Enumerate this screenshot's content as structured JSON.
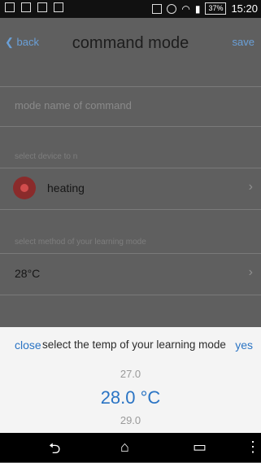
{
  "status_bar": {
    "time": "15:20",
    "battery_label": "37%"
  },
  "app_bar": {
    "back_label": "back",
    "title": "command mode",
    "save_label": "save"
  },
  "form": {
    "mode_name_placeholder": "mode name of command",
    "device_section_label": "select device to n",
    "device_name": "heating",
    "learning_mode_section_label": "select method of your learning mode",
    "temperature_value": "28°C"
  },
  "sheet": {
    "close_label": "close",
    "title": "select the temp of your learning mode",
    "yes_label": "yes",
    "picker": {
      "previous": "27.0",
      "selected": "28.0 °C",
      "next": "29.0"
    }
  },
  "colors": {
    "accent": "#2a74c4",
    "dim_overlay": "#5f5f5f",
    "sheet_bg": "#f4f4f4"
  },
  "icons": {
    "notification_icons": [
      "image-icon",
      "facebook-icon",
      "wallet-icon",
      "clipboard-icon"
    ],
    "status_icons": [
      "tty-icon",
      "alarm-icon",
      "wifi-icon",
      "signal-icon",
      "battery-icon"
    ]
  }
}
